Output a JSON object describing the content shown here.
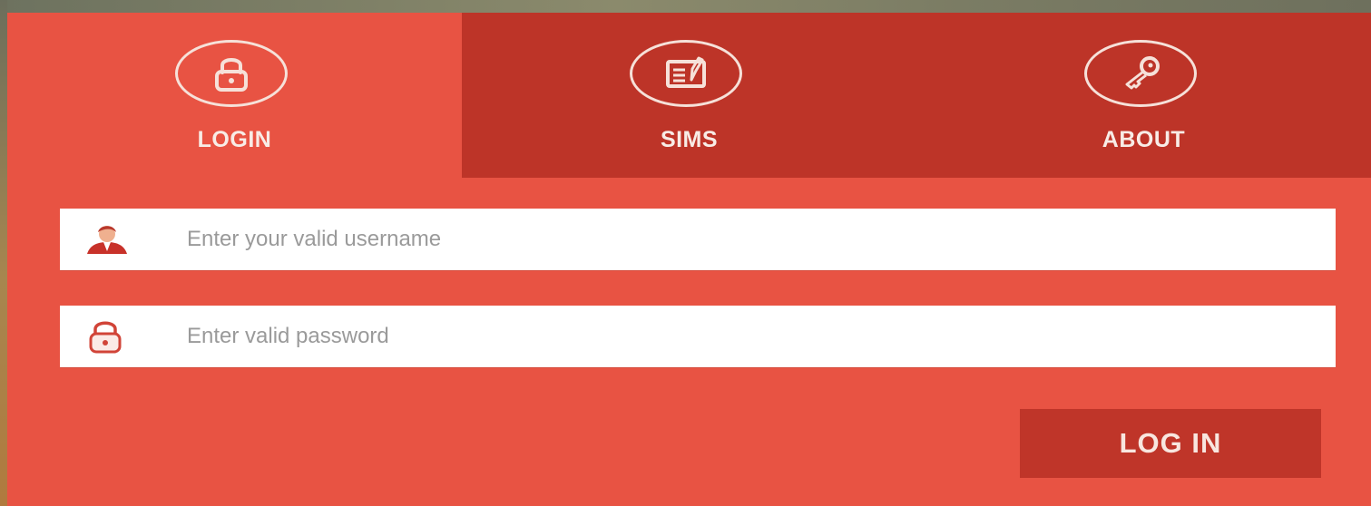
{
  "tabs": [
    {
      "label": "LOGIN",
      "icon": "lock-icon"
    },
    {
      "label": "SIMS",
      "icon": "document-edit-icon"
    },
    {
      "label": "ABOUT",
      "icon": "key-icon"
    }
  ],
  "form": {
    "username_placeholder": "Enter your valid username",
    "password_placeholder": "Enter valid password",
    "username_icon": "user-icon",
    "password_icon": "lock-icon"
  },
  "actions": {
    "login_label": "LOG IN"
  },
  "colors": {
    "active_tab": "#e85343",
    "inactive_tab": "#bd3428",
    "button": "#bf3529",
    "panel": "#e85343"
  }
}
